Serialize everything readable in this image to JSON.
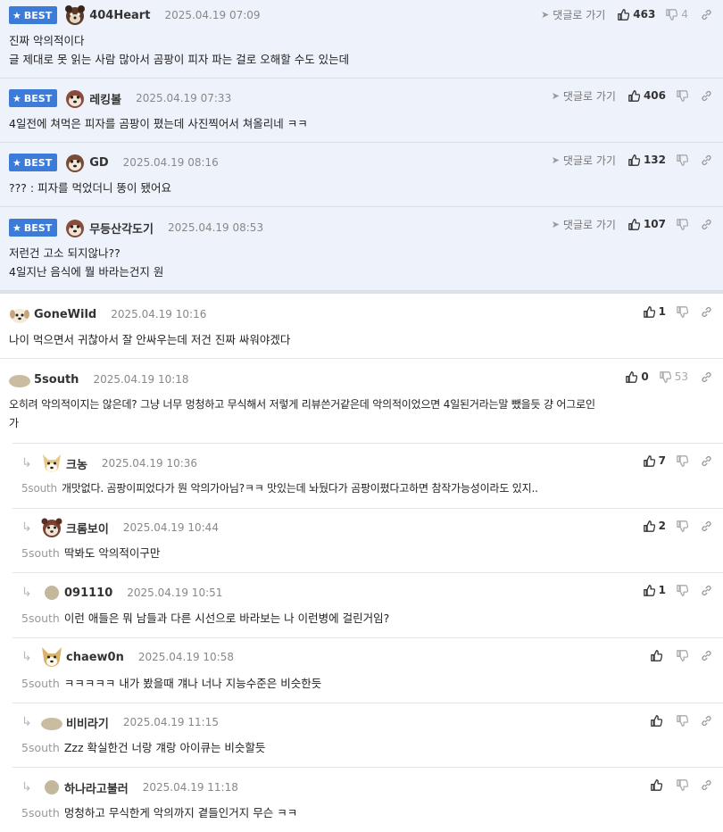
{
  "labels": {
    "best": "BEST",
    "goto": "댓글로 가기"
  },
  "colors": {
    "best_background": "#eef3fb",
    "best_badge": "#3d7bd9",
    "mention": "#999999"
  },
  "best_comments": [
    {
      "nick": "404Heart",
      "date": "2025.04.19 07:09",
      "likes": "463",
      "dislikes": "4",
      "lines": [
        "진짜 악의적이다",
        "글 제대로 못 읽는 사람 많아서 곰팡이 피자 파는 걸로 오해할 수도 있는데"
      ]
    },
    {
      "nick": "레킹볼",
      "date": "2025.04.19 07:33",
      "likes": "406",
      "dislikes": "",
      "lines": [
        "4일전에 쳐먹은 피자를 곰팡이 폈는데 사진찍어서 쳐올리네 ㅋㅋ"
      ]
    },
    {
      "nick": "GD",
      "date": "2025.04.19 08:16",
      "likes": "132",
      "dislikes": "",
      "lines": [
        "??? : 피자를 먹었더니 똥이 됐어요"
      ]
    },
    {
      "nick": "무등산각도기",
      "date": "2025.04.19 08:53",
      "likes": "107",
      "dislikes": "",
      "lines": [
        "저런건 고소 되지않나??",
        "4일지난 음식에 뭘 바라는건지 원"
      ]
    }
  ],
  "comments": [
    {
      "nick": "GoneWild",
      "date": "2025.04.19 10:16",
      "likes": "1",
      "dislikes": "",
      "lines": [
        "나이 먹으면서 귀찮아서 잘 안싸우는데 저건 진짜 싸워야겠다"
      ]
    },
    {
      "nick": "5south",
      "date": "2025.04.19 10:18",
      "likes": "0",
      "dislikes": "53",
      "lines": [
        "오히려 악의적이지는 않은데? 그냥 너무 멍청하고 무식해서 저렇게 리뷰쓴거같은데 악의적이었으면 4일된거라는말 뺐을듯 걍 어그로인",
        "가"
      ]
    }
  ],
  "replies": [
    {
      "nick": "크농",
      "date": "2025.04.19 10:36",
      "likes": "7",
      "mention": "5south",
      "text": "개맛없다. 곰팡이피었다가 뭔 악의가아님?ㅋㅋ 맛있는데 놔뒀다가 곰팡이폈다고하면 참작가능성이라도 있지.."
    },
    {
      "nick": "크롬보이",
      "date": "2025.04.19 10:44",
      "likes": "2",
      "mention": "5south",
      "text": "딱봐도 악의적이구만"
    },
    {
      "nick": "091110",
      "date": "2025.04.19 10:51",
      "likes": "1",
      "mention": "5south",
      "text": "이런 애들은 뭐 남들과 다른 시선으로 바라보는 나 이런병에 걸린거임?"
    },
    {
      "nick": "chaew0n",
      "date": "2025.04.19 10:58",
      "likes": "",
      "mention": "5south",
      "text": "ㅋㅋㅋㅋㅋ 내가 봤을때 걔나 너나 지능수준은 비슷한듯"
    },
    {
      "nick": "비비라기",
      "date": "2025.04.19 11:15",
      "likes": "",
      "mention": "5south",
      "text": "Zzz 확실한건 너랑 걔랑 아이큐는 비슷할듯"
    },
    {
      "nick": "하나라고불러",
      "date": "2025.04.19 11:18",
      "likes": "",
      "mention": "5south",
      "text": "멍청하고 무식한게 악의까지 곁들인거지 무슨 ㅋㅋ"
    }
  ]
}
